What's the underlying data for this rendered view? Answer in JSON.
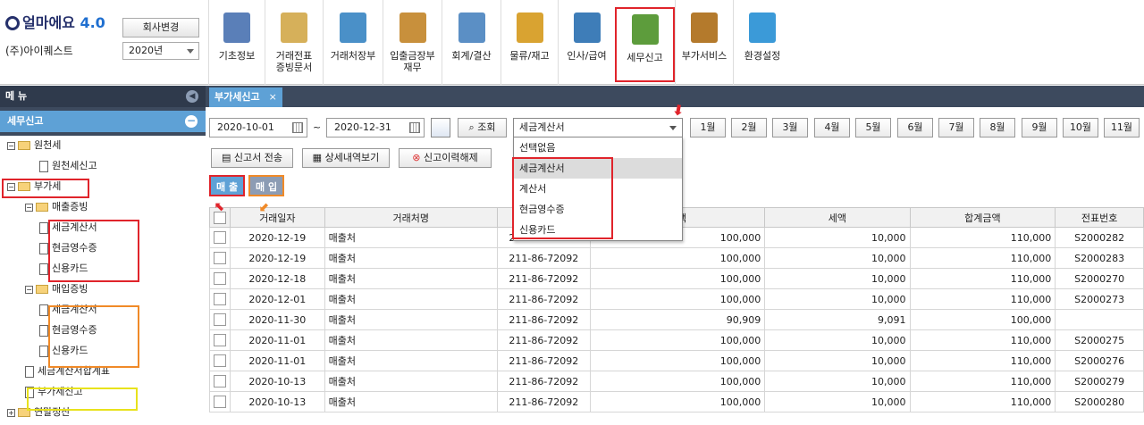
{
  "app": {
    "logo": "얼마에요",
    "version": "4.0",
    "company": "(주)아이퀘스트",
    "change_company": "회사변경",
    "year": "2020년"
  },
  "toolbar": [
    {
      "label": "기초정보",
      "icon": "basic-info-icon"
    },
    {
      "label": "거래전표\n증빙문서",
      "icon": "voucher-icon"
    },
    {
      "label": "거래처장부",
      "icon": "ledger-book-icon"
    },
    {
      "label": "입출금장부\n재무",
      "icon": "money-bag-icon"
    },
    {
      "label": "회계/결산",
      "icon": "accounting-icon"
    },
    {
      "label": "물류/재고",
      "icon": "logistics-icon"
    },
    {
      "label": "인사/급여",
      "icon": "hr-payroll-icon"
    },
    {
      "label": "세무신고",
      "icon": "tax-report-icon"
    },
    {
      "label": "부가서비스",
      "icon": "bank-icon"
    },
    {
      "label": "환경설정",
      "icon": "gear-icon"
    }
  ],
  "sidebar": {
    "header": "메 뉴",
    "section": "세무신고",
    "tree": [
      {
        "label": "원천세",
        "type": "folder",
        "level": 0,
        "toggle": "−"
      },
      {
        "label": "원천세신고",
        "type": "doc",
        "level": 2
      },
      {
        "label": "부가세",
        "type": "folder",
        "level": 0,
        "toggle": "−"
      },
      {
        "label": "매출증빙",
        "type": "folder",
        "level": 1,
        "toggle": "−"
      },
      {
        "label": "세금계산서",
        "type": "doc",
        "level": 2
      },
      {
        "label": "현금영수증",
        "type": "doc",
        "level": 2
      },
      {
        "label": "신용카드",
        "type": "doc",
        "level": 2
      },
      {
        "label": "매입증빙",
        "type": "folder",
        "level": 1,
        "toggle": "−"
      },
      {
        "label": "세금계산서",
        "type": "doc",
        "level": 2
      },
      {
        "label": "현금영수증",
        "type": "doc",
        "level": 2
      },
      {
        "label": "신용카드",
        "type": "doc",
        "level": 2
      },
      {
        "label": "세금계산서합계표",
        "type": "doc",
        "level": 1
      },
      {
        "label": "부가세신고",
        "type": "doc",
        "level": 1
      },
      {
        "label": "연말정산",
        "type": "folder",
        "level": 0,
        "toggle": "+"
      }
    ]
  },
  "tab": {
    "label": "부가세신고",
    "close": "×"
  },
  "filter": {
    "date_from": "2020-10-01",
    "tilde": "~",
    "date_to": "2020-12-31",
    "search": "조회",
    "selected": "세금계산서",
    "options": [
      "선택없음",
      "세금계산서",
      "계산서",
      "현금영수증",
      "신용카드"
    ],
    "months": [
      "1월",
      "2월",
      "3월",
      "4월",
      "5월",
      "6월",
      "7월",
      "8월",
      "9월",
      "10월",
      "11월"
    ]
  },
  "actions": {
    "send": "신고서 전송",
    "detail": "상세내역보기",
    "cancel": "신고이력해제"
  },
  "subtabs": {
    "sales": "매 출",
    "purchase": "매 입"
  },
  "table": {
    "headers": [
      "",
      "거래일자",
      "거래처명",
      "",
      "가액",
      "세액",
      "합계금액",
      "전표번호"
    ],
    "rows": [
      [
        "2020-12-19",
        "매출처",
        "211-86-72092",
        "100,000",
        "10,000",
        "110,000",
        "S2000282"
      ],
      [
        "2020-12-19",
        "매출처",
        "211-86-72092",
        "100,000",
        "10,000",
        "110,000",
        "S2000283"
      ],
      [
        "2020-12-18",
        "매출처",
        "211-86-72092",
        "100,000",
        "10,000",
        "110,000",
        "S2000270"
      ],
      [
        "2020-12-01",
        "매출처",
        "211-86-72092",
        "100,000",
        "10,000",
        "110,000",
        "S2000273"
      ],
      [
        "2020-11-30",
        "매출처",
        "211-86-72092",
        "90,909",
        "9,091",
        "100,000",
        ""
      ],
      [
        "2020-11-01",
        "매출처",
        "211-86-72092",
        "100,000",
        "10,000",
        "110,000",
        "S2000275"
      ],
      [
        "2020-11-01",
        "매출처",
        "211-86-72092",
        "100,000",
        "10,000",
        "110,000",
        "S2000276"
      ],
      [
        "2020-10-13",
        "매출처",
        "211-86-72092",
        "100,000",
        "10,000",
        "110,000",
        "S2000279"
      ],
      [
        "2020-10-13",
        "매출처",
        "211-86-72092",
        "100,000",
        "10,000",
        "110,000",
        "S2000280"
      ]
    ]
  },
  "colors": {
    "navy": "#3d4a5e",
    "accent": "#5ea1d6",
    "red": "#e0242b",
    "orange": "#f08a28",
    "yellow": "#e8e21c"
  }
}
